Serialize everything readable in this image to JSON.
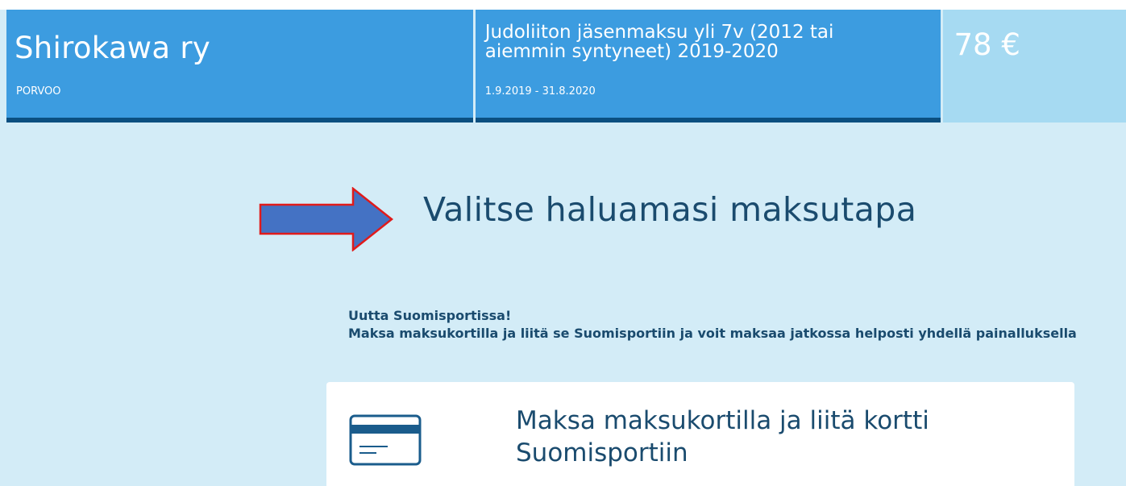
{
  "header": {
    "club_name": "Shirokawa ry",
    "club_city": "PORVOO",
    "product_title": "Judoliiton jäsenmaksu yli 7v (2012 tai aiemmin syntyneet) 2019-2020",
    "product_dates": "1.9.2019 - 31.8.2020",
    "price": "78 €"
  },
  "main": {
    "title": "Valitse haluamasi maksutapa",
    "notice_heading": "Uutta Suomisportissa!",
    "notice_text": "Maksa maksukortilla ja liitä se Suomisportiin ja voit maksaa jatkossa helposti yhdellä painalluksella",
    "payment_option": {
      "label": "Maksa maksukortilla ja liitä kortti Suomisportiin",
      "icon": "credit-card-icon"
    }
  },
  "annotation": {
    "icon": "arrow-right-icon",
    "fill_color": "#4472c4",
    "stroke_color": "#e01b1b"
  },
  "colors": {
    "header_blue": "#3c9ce0",
    "header_dark_border": "#0b4f80",
    "price_bg": "#a6daf2",
    "page_bg": "#d3ecf7",
    "text_dark": "#1a4b6e"
  }
}
